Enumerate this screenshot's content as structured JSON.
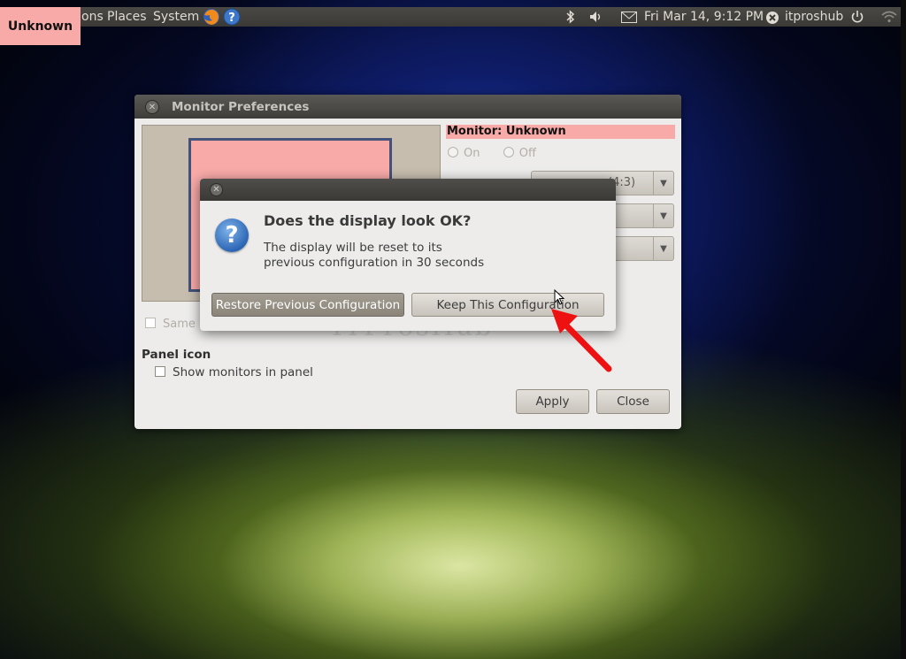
{
  "panel": {
    "applications_partial": "ons",
    "places": "Places",
    "system": "System",
    "clock": "Fri Mar 14,  9:12 PM",
    "user": "itproshub",
    "icons": [
      "firefox-icon",
      "help-icon",
      "bluetooth-icon",
      "volume-icon",
      "mail-icon",
      "user-icon",
      "power-icon",
      "wifi-icon"
    ]
  },
  "badge": {
    "label": "Unknown",
    "color": "#f8aaa8"
  },
  "monitor_prefs": {
    "title": "Monitor Preferences",
    "monitor_label": "Monitor: Unknown",
    "on_label": "On",
    "off_label": "Off",
    "resolution_value_partial": "(4:3)",
    "same_image_partial": "Same i",
    "panel_icon_heading": "Panel icon",
    "show_monitors_label": "Show monitors in panel",
    "apply_label": "Apply",
    "close_label": "Close"
  },
  "confirm_dialog": {
    "heading": "Does the display look OK?",
    "line1": "The display will be reset to its",
    "line2": "previous configuration in 30 seconds",
    "restore_label": "Restore Previous Configuration",
    "keep_label": "Keep This Configuration"
  },
  "watermark": "ITProsHub",
  "colors": {
    "highlight": "#f8aaa8",
    "arrow": "#ee1111"
  }
}
